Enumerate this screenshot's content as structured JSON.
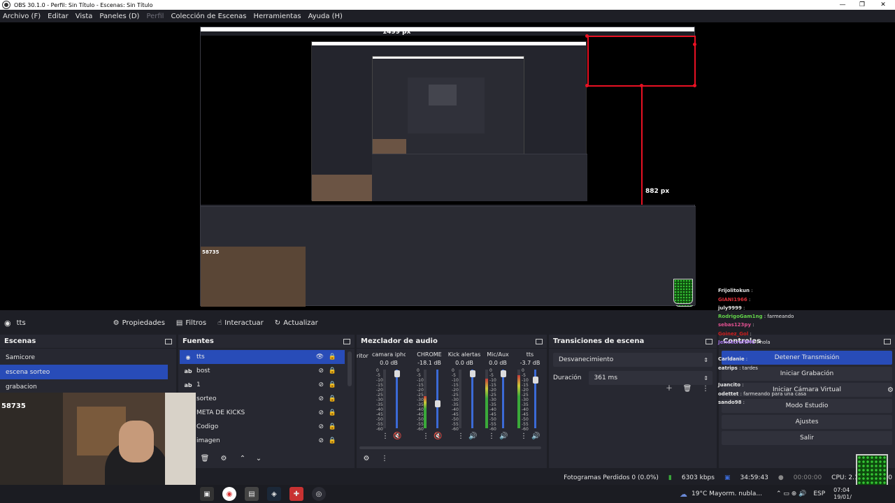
{
  "window": {
    "title": "OBS 30.1.0 - Perfil: Sin Título - Escenas: Sin Título",
    "minimize": "—",
    "maximize": "❐",
    "close": "✕"
  },
  "menu": [
    {
      "label": "Archivo (F)",
      "disabled": false
    },
    {
      "label": "Editar",
      "disabled": false
    },
    {
      "label": "Vista",
      "disabled": false
    },
    {
      "label": "Paneles (D)",
      "disabled": false
    },
    {
      "label": "Perfil",
      "disabled": true
    },
    {
      "label": "Colección de Escenas",
      "disabled": false
    },
    {
      "label": "Herramientas",
      "disabled": false
    },
    {
      "label": "Ayuda (H)",
      "disabled": false
    }
  ],
  "preview": {
    "width_label": "1499 px",
    "height_label": "882 px",
    "nested_width_label": "1499 px",
    "nested_height_label": "882 px",
    "webcam_overlay": "58735"
  },
  "toolbar": {
    "source_name": "tts",
    "properties": "Propiedades",
    "filters": "Filtros",
    "interact": "Interactuar",
    "refresh": "Actualizar"
  },
  "scenes": {
    "title": "Escenas",
    "items": [
      "Samicore",
      "escena sorteo",
      "grabacion"
    ],
    "selected": 1
  },
  "sources": {
    "title": "Fuentes",
    "items": [
      {
        "name": "tts",
        "icon": "globe",
        "visible": true
      },
      {
        "name": "bost",
        "icon": "text",
        "visible": false
      },
      {
        "name": "1",
        "icon": "text",
        "visible": false
      },
      {
        "name": "sorteo",
        "icon": "",
        "visible": false
      },
      {
        "name": "META DE KICKS",
        "icon": "",
        "visible": false
      },
      {
        "name": "Codigo",
        "icon": "",
        "visible": false
      },
      {
        "name": "imagen",
        "icon": "",
        "visible": false
      }
    ]
  },
  "mixer": {
    "title": "Mezclador de audio",
    "partial_label": "ritor",
    "channels": [
      {
        "name": "camara iphone",
        "db": "0.0 dB",
        "level": 0.0,
        "muted": true
      },
      {
        "name": "CHROME",
        "db": "-18.1 dB",
        "level": 0.55,
        "muted": true
      },
      {
        "name": "Kick alertas",
        "db": "0.0 dB",
        "level": 0.0,
        "muted": false
      },
      {
        "name": "Mic/Aux",
        "db": "0.0 dB",
        "level": 0.85,
        "muted": false
      },
      {
        "name": "tts",
        "db": "-3.7 dB",
        "level": 0.9,
        "muted": false
      }
    ],
    "scale": [
      "0",
      "-5",
      "-10",
      "-15",
      "-20",
      "-25",
      "-30",
      "-35",
      "-40",
      "-45",
      "-50",
      "-55",
      "-60"
    ]
  },
  "transitions": {
    "title": "Transiciones de escena",
    "current": "Desvanecimiento",
    "duration_label": "Duración",
    "duration_value": "361 ms"
  },
  "controls": {
    "title": "Controles",
    "stop_stream": "Detener Transmisión",
    "start_recording": "Iniciar Grabación",
    "virtual_cam": "Iniciar Cámara Virtual",
    "studio_mode": "Modo Estudio",
    "settings": "Ajustes",
    "exit": "Salir"
  },
  "chat": [
    {
      "user": "",
      "text": "",
      "color": "#cfcfcf"
    },
    {
      "user": "Frijolitokun",
      "text": " :",
      "color": "#e6e6e6"
    },
    {
      "user": "GIANI1966",
      "text": " :",
      "color": "#e0303a"
    },
    {
      "user": "july9999",
      "text": " :",
      "color": "#e6e6e6"
    },
    {
      "user": "RodrigoGam1ng",
      "text": " : farmeando",
      "color": "#63d34a"
    },
    {
      "user": "sebas123py",
      "text": " :",
      "color": "#e05090"
    },
    {
      "user": "Goinez_Gol",
      "text": " :",
      "color": "#d02020"
    },
    {
      "user": "JerickcraftMC",
      "text": " : hola",
      "color": "#a070e0"
    },
    {
      "user": "Carldanie",
      "text": " :",
      "color": "#e6e6e6"
    },
    {
      "user": "eatrips",
      "text": " : tardes",
      "color": "#e6e6e6"
    },
    {
      "user": "",
      "text": "",
      "color": "#e0303a"
    },
    {
      "user": "Juancito",
      "text": " :",
      "color": "#e6e6e6"
    },
    {
      "user": "odettet",
      "text": " : farmeando para una casa",
      "color": "#e6e6e6"
    },
    {
      "user": "sando98",
      "text": " :",
      "color": "#e6e6e6"
    }
  ],
  "status": {
    "dropped_frames": "Fotogramas Perdidos 0 (0.0%)",
    "bitrate": "6303 kbps",
    "stream_time": "34:59:43",
    "rec_time": "00:00:00",
    "cpu": "CPU: 2.1%",
    "fps": "60.00"
  },
  "taskbar": {
    "weather": "19°C  Mayorm. nubla...",
    "lang": "ESP",
    "time": "07:04",
    "date": "19/01/"
  },
  "colors": {
    "accent": "#284cb8",
    "dock_bg": "#272831",
    "app_bg": "#1e1f26",
    "red_guide": "#e81123"
  }
}
